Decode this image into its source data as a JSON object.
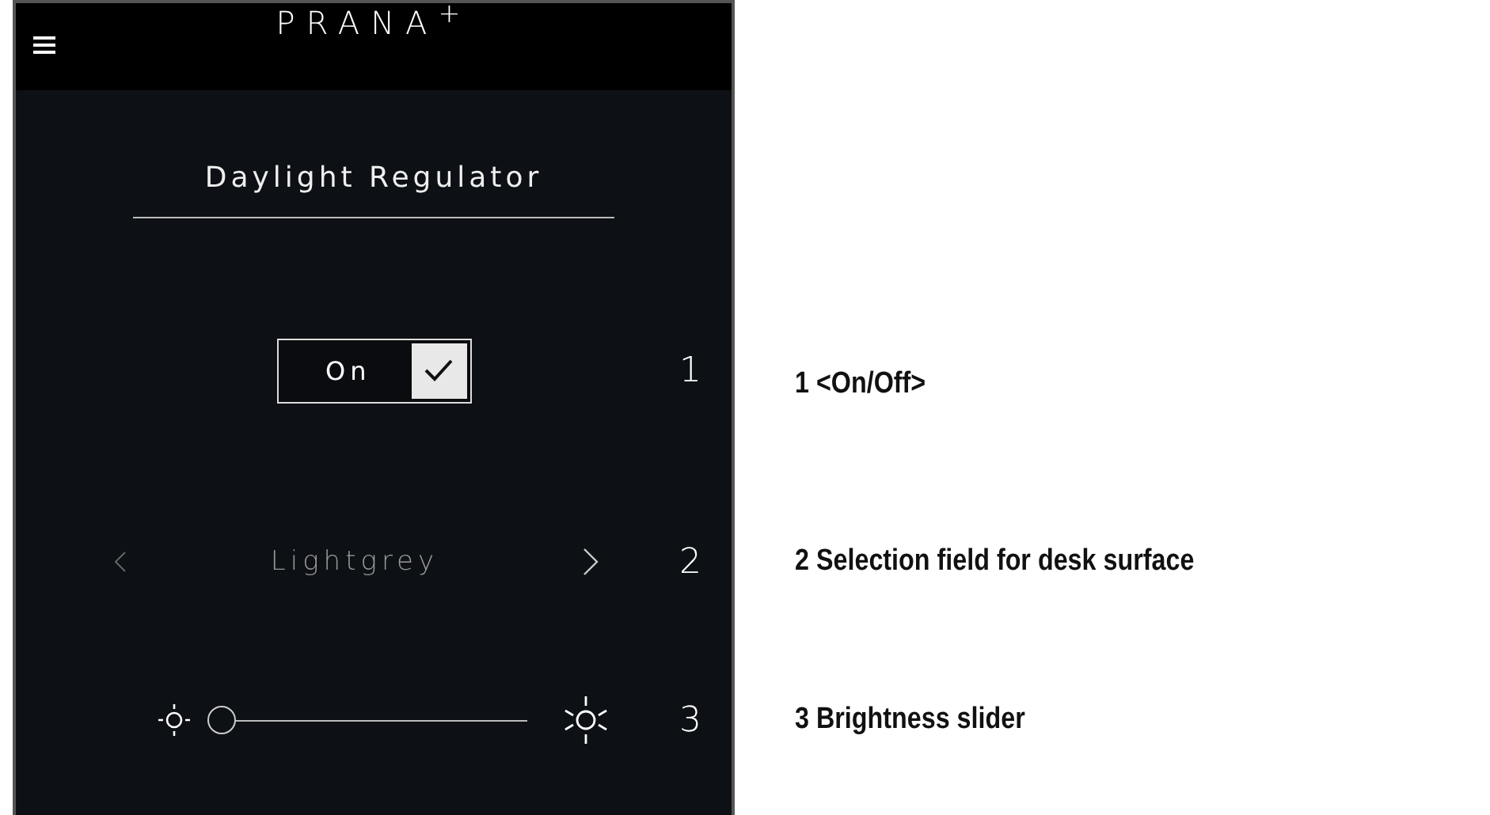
{
  "header": {
    "logo": "PRANA$^{+}$"
  },
  "title": "Daylight Regulator",
  "toggle": {
    "label": "On",
    "checked": true
  },
  "selector": {
    "value": "Lightgrey"
  },
  "slider": {
    "level": 0
  },
  "markers": [
    "1",
    "2",
    "3"
  ],
  "annotations": [
    {
      "text": "1 <On/Off>"
    },
    {
      "text": "2 Selection field for desk surface"
    },
    {
      "text": "3 Brightness slider"
    }
  ]
}
